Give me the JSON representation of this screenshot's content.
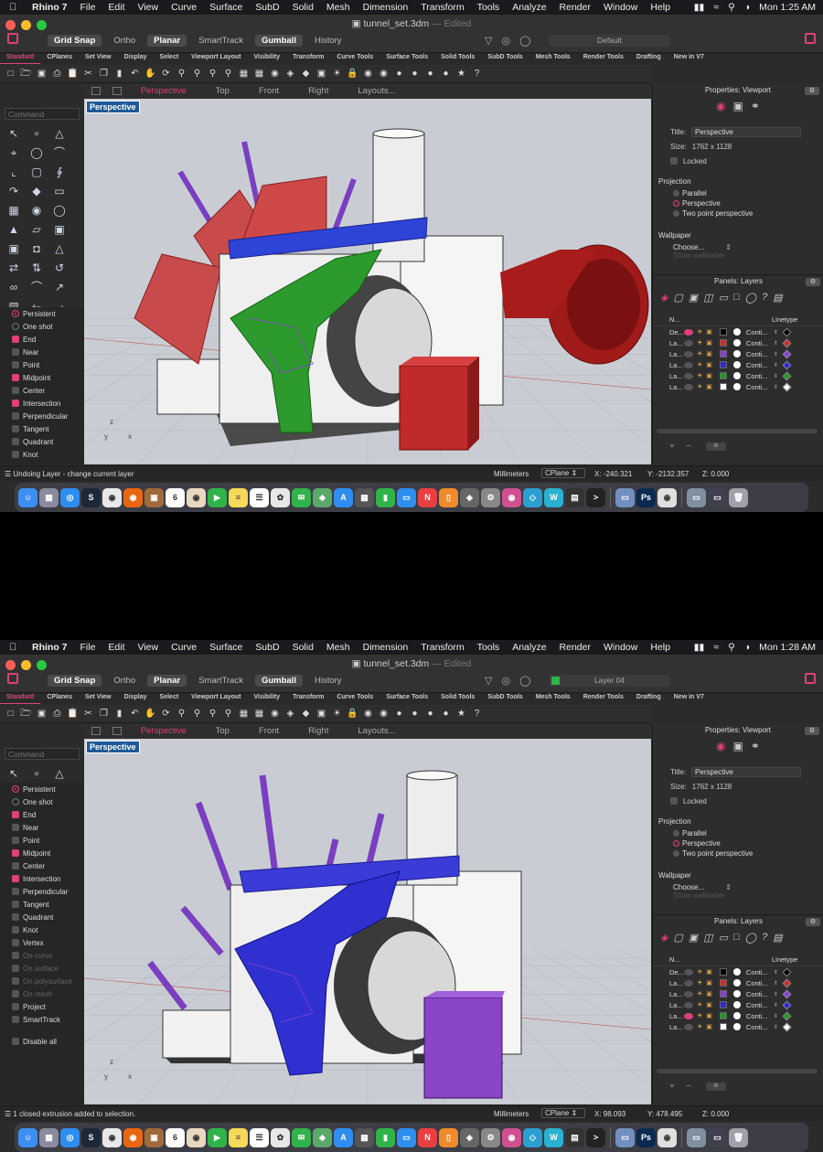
{
  "menubar": {
    "app": "Rhino 7",
    "items": [
      "File",
      "Edit",
      "View",
      "Curve",
      "Surface",
      "SubD",
      "Solid",
      "Mesh",
      "Dimension",
      "Transform",
      "Tools",
      "Analyze",
      "Render",
      "Window",
      "Help"
    ]
  },
  "toggles": [
    "Grid Snap",
    "Ortho",
    "Planar",
    "SmartTrack",
    "Gumball",
    "History"
  ],
  "tabs": [
    "Standard",
    "CPlanes",
    "Set View",
    "Display",
    "Select",
    "Viewport Layout",
    "Visibility",
    "Transform",
    "Curve Tools",
    "Surface Tools",
    "Solid Tools",
    "SubD Tools",
    "Mesh Tools",
    "Render Tools",
    "Drafting",
    "New in V7"
  ],
  "viewport_tabs": [
    "Perspective",
    "Top",
    "Front",
    "Right",
    "Layouts..."
  ],
  "command_placeholder": "Command",
  "osnap": {
    "persistent": "Persistent",
    "one_shot": "One shot",
    "items": [
      "End",
      "Near",
      "Point",
      "Midpoint",
      "Center",
      "Intersection",
      "Perpendicular",
      "Tangent",
      "Quadrant",
      "Knot",
      "Vertex",
      "On curve",
      "On surface",
      "On polysurface",
      "On mesh",
      "Project",
      "SmartTrack"
    ],
    "disable_all": "Disable all"
  },
  "properties": {
    "header": "Properties: Viewport",
    "title_label": "Title:",
    "title_value": "Perspective",
    "size_label": "Size:",
    "size_value": "1762 x 1128",
    "locked": "Locked",
    "projection": "Projection",
    "proj_options": [
      "Parallel",
      "Perspective",
      "Two point perspective"
    ],
    "wallpaper": "Wallpaper",
    "choose": "Choose...",
    "show_wallpaper": "Show wallpaper"
  },
  "layers_panel": {
    "header": "Panels: Layers",
    "col_name": "N...",
    "col_linetype": "Linetype",
    "linetype": "Conti...",
    "rows": [
      {
        "name": "De...",
        "color": "#000000"
      },
      {
        "name": "La...",
        "color": "#d42a2a"
      },
      {
        "name": "La...",
        "color": "#8a3fd4"
      },
      {
        "name": "La...",
        "color": "#2a2ad4"
      },
      {
        "name": "La...",
        "color": "#1f9a2a"
      },
      {
        "name": "La...",
        "color": "#ffffff"
      }
    ]
  },
  "units": "Millimeters",
  "cplane": "CPlane",
  "screens": [
    {
      "time": "Mon  1:25 AM",
      "document": "tunnel_set.3dm",
      "edited": "— Edited",
      "layer": "Default",
      "status_msg": "Undoing Layer - change current layer",
      "x": "X: -240.321",
      "y": "Y: -2132.357",
      "z": "Z: 0.000",
      "current_layer_index": 0
    },
    {
      "time": "Mon  1:28 AM",
      "document": "tunnel_set.3dm",
      "edited": "— Edited",
      "layer": "Layer 04",
      "status_msg": "1 closed extrusion added to selection.",
      "x": "X: 98.093",
      "y": "Y: 478.495",
      "z": "Z: 0.000",
      "current_layer_index": 4
    }
  ],
  "viewport_label": "Perspective",
  "colors": {
    "accent": "#e0407a",
    "viewport_bg": "#c9cdd3"
  }
}
